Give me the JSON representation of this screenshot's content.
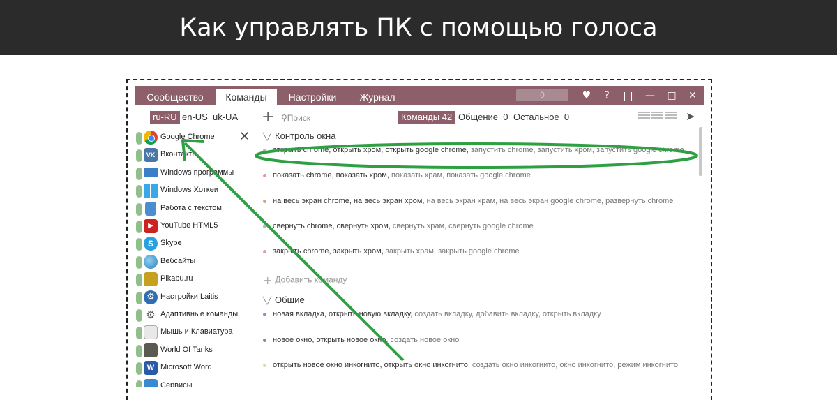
{
  "banner": {
    "title": "Как управлять ПК с помощью голоса"
  },
  "app": {
    "tabs": [
      "Сообщество",
      "Команды",
      "Настройки",
      "Журнал"
    ],
    "active_tab": "Команды",
    "counter": "0",
    "window_controls": [
      "heart-icon",
      "help-icon",
      "pause-icon",
      "minimize-icon",
      "maximize-icon",
      "close-icon"
    ],
    "languages": [
      "ru-RU",
      "en-US",
      "uk-UA"
    ],
    "active_language": "ru-RU",
    "search_placeholder": "Поиск",
    "filters": [
      {
        "label": "Команды",
        "count": "42"
      },
      {
        "label": "Общение",
        "count": "0"
      },
      {
        "label": "Остальное",
        "count": "0"
      }
    ],
    "sidebar": [
      {
        "label": "Google Chrome",
        "icon": "chrome-icon"
      },
      {
        "label": "Вконтакте",
        "icon": "vk-icon"
      },
      {
        "label": "Windows программы",
        "icon": "monitor-icon"
      },
      {
        "label": "Windows Хоткеи",
        "icon": "windows-icon"
      },
      {
        "label": "Работа с текстом",
        "icon": "document-icon"
      },
      {
        "label": "YouTube HTML5",
        "icon": "youtube-icon"
      },
      {
        "label": "Skype",
        "icon": "skype-icon"
      },
      {
        "label": "Вебсайты",
        "icon": "globe-icon"
      },
      {
        "label": "Pikabu.ru",
        "icon": "pikabu-icon"
      },
      {
        "label": "Настройки Laitis",
        "icon": "gear-icon"
      },
      {
        "label": "Адаптивные команды",
        "icon": "adaptive-icon"
      },
      {
        "label": "Мышь и Клавиатура",
        "icon": "mouse-keyboard-icon"
      },
      {
        "label": "World Of Tanks",
        "icon": "tank-icon"
      },
      {
        "label": "Microsoft Word",
        "icon": "word-icon"
      },
      {
        "label": "Сервисы",
        "icon": "services-icon"
      }
    ],
    "groups": [
      {
        "title": "Контроль окна",
        "commands": [
          {
            "main": "открыть chrome, открыть хром, открыть google chrome,",
            "alt": " запустить chrome, запустить хром, запустить google chrome",
            "dot": "#a5c88a"
          },
          {
            "main": "показать chrome, показать хром,",
            "alt": " показать храм, показать google chrome",
            "dot": "#d99aa4"
          },
          {
            "main": "на весь экран chrome, на весь экран хром,",
            "alt": " на весь экран храм, на весь экран google chrome, развернуть chrome",
            "dot": "#d9a08a"
          },
          {
            "main": "свернуть chrome, свернуть хром,",
            "alt": " свернуть храм, свернуть google chrome",
            "dot": "#c5a8d0"
          },
          {
            "main": "закрыть chrome, закрыть хром,",
            "alt": " закрыть храм, закрыть google chrome",
            "dot": "#e0a0a8"
          }
        ],
        "add_label": "Добавить команду"
      },
      {
        "title": "Общие",
        "commands": [
          {
            "main": "новая вкладка, открыть новую вкладку,",
            "alt": " создать вкладку, добавить вкладку, открыть вкладку",
            "dot": "#8a90d8"
          },
          {
            "main": "новое окно, открыть новое окно,",
            "alt": " создать новое окно",
            "dot": "#8a80b8"
          },
          {
            "main": "открыть новое окно инкогнито, открыть окно инкогнито,",
            "alt": " создать окно инкогнито, окно инкогнито, режим инкогнито",
            "dot": "#d8e0a0"
          }
        ]
      }
    ]
  },
  "colors": {
    "accent": "#8c5f6a",
    "annotation": "#2ea043"
  }
}
